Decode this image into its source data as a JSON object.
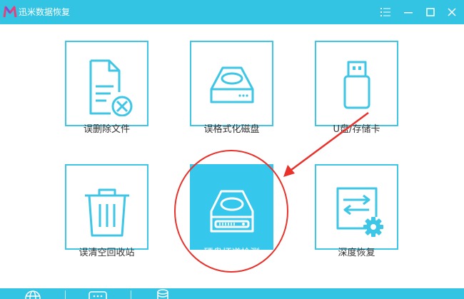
{
  "app": {
    "title": "迅米数据恢复"
  },
  "tiles": [
    {
      "label": "误删除文件",
      "icon": "deleted-file-icon"
    },
    {
      "label": "误格式化磁盘",
      "icon": "hard-drive-icon"
    },
    {
      "label": "U盘/存储卡",
      "icon": "usb-drive-icon"
    },
    {
      "label": "误清空回收站",
      "icon": "recycle-bin-icon"
    },
    {
      "label": "硬盘坏道检测",
      "icon": "disk-scan-icon",
      "selected": true
    },
    {
      "label": "深度恢复",
      "icon": "deep-recovery-icon"
    }
  ],
  "colors": {
    "accent": "#33c3e3",
    "annotation": "#e8322b"
  }
}
